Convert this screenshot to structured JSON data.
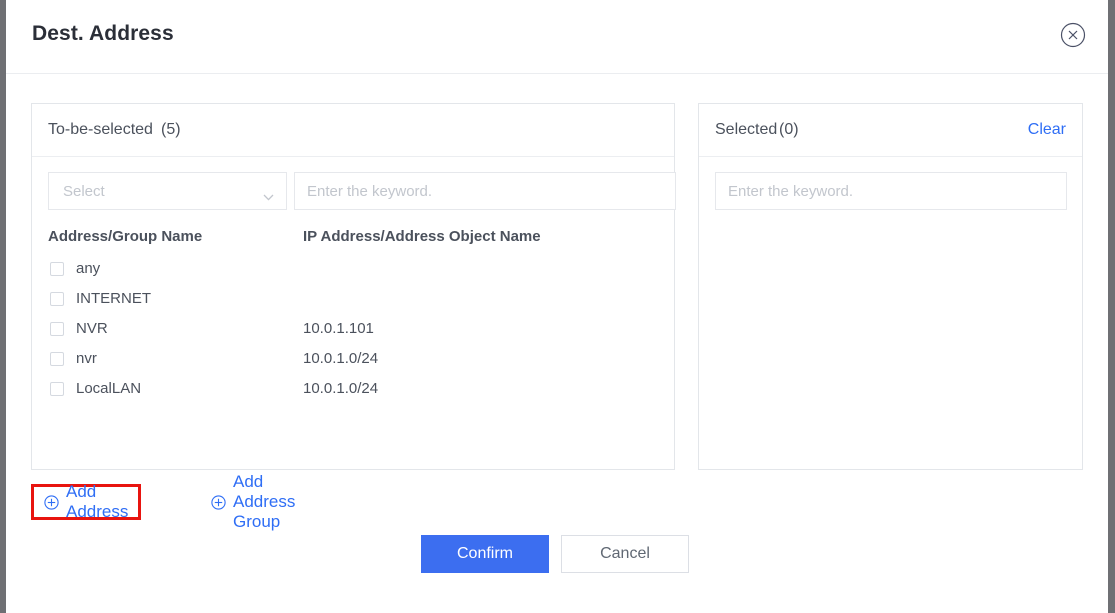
{
  "modal": {
    "title": "Dest. Address",
    "close_icon": "close-circle-icon"
  },
  "left_panel": {
    "title": "To-be-selected",
    "count": "(5)",
    "select": {
      "value": "Select",
      "chevron_icon": "chevron-down-icon"
    },
    "search": {
      "placeholder": "Enter the keyword.",
      "value": ""
    },
    "columns": [
      "Address/Group Name",
      "IP Address/Address Object Name"
    ],
    "rows": [
      {
        "name": "any",
        "ip": "",
        "checked": false
      },
      {
        "name": "INTERNET",
        "ip": "",
        "checked": false
      },
      {
        "name": "NVR",
        "ip": "10.0.1.101",
        "checked": false
      },
      {
        "name": "nvr",
        "ip": "10.0.1.0/24",
        "checked": false
      },
      {
        "name": "LocalLAN",
        "ip": "10.0.1.0/24",
        "checked": false
      }
    ]
  },
  "right_panel": {
    "title": "Selected",
    "count": "(0)",
    "clear_label": "Clear",
    "search": {
      "placeholder": "Enter the keyword.",
      "value": ""
    }
  },
  "actions": {
    "add_address": "Add Address",
    "add_address_group": "Add Address Group",
    "plus_icon": "plus-circle-icon"
  },
  "footer": {
    "confirm": "Confirm",
    "cancel": "Cancel"
  },
  "colors": {
    "accent_blue": "#3c6ef5",
    "link_blue": "#2f6ef5",
    "highlight_red": "#e8140f",
    "text": "#4b515c",
    "title": "#2b2f38",
    "border": "#e3e6ea",
    "placeholder": "#c2c6cd"
  }
}
